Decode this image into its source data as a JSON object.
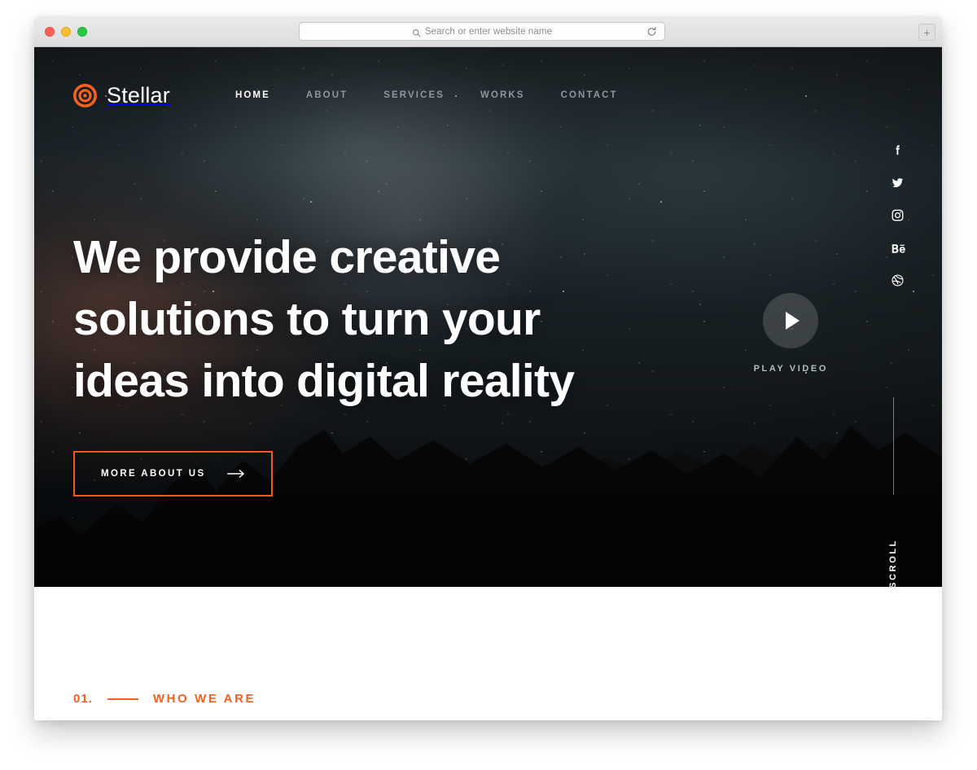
{
  "browser": {
    "traffic_lights": [
      {
        "name": "close",
        "color": "#ff5f57"
      },
      {
        "name": "minimize",
        "color": "#febc2e"
      },
      {
        "name": "zoom",
        "color": "#28c840"
      }
    ],
    "address_placeholder": "Search or enter website name",
    "address_value": "",
    "search_icon": "search-icon",
    "reload_icon": "reload-icon",
    "newtab_label": "+"
  },
  "site": {
    "brand": {
      "name": "Stellar",
      "logo_icon": "target-rings-icon"
    },
    "nav": [
      {
        "label": "HOME",
        "active": true
      },
      {
        "label": "ABOUT",
        "active": false
      },
      {
        "label": "SERVICES",
        "active": false
      },
      {
        "label": "WORKS",
        "active": false
      },
      {
        "label": "CONTACT",
        "active": false
      }
    ],
    "social": [
      {
        "name": "facebook-icon",
        "label": "Facebook"
      },
      {
        "name": "twitter-icon",
        "label": "Twitter"
      },
      {
        "name": "instagram-icon",
        "label": "Instagram"
      },
      {
        "name": "behance-icon",
        "label": "Behance"
      },
      {
        "name": "dribbble-icon",
        "label": "Dribbble"
      }
    ],
    "hero": {
      "title": "We provide creative solutions to turn your ideas into digital reality",
      "cta_label": "MORE ABOUT US",
      "cta_arrow_icon": "arrow-right-icon",
      "play_label": "PLAY VIDEO",
      "play_icon": "play-triangle-icon",
      "scroll_label": "SCROLL"
    },
    "about": {
      "number": "01.",
      "title": "WHO WE ARE"
    },
    "colors": {
      "accent": "#f4601e",
      "cta_border": "#f05a1e",
      "nav_inactive": "#8f979c",
      "nav_active": "#ffffff",
      "hero_text": "#ffffff",
      "play_label": "#b6bcc0",
      "page_background": "#ffffff"
    }
  }
}
